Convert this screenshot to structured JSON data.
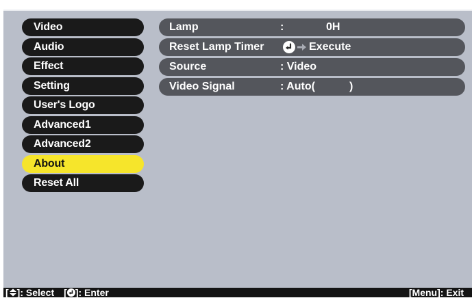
{
  "sidebar": {
    "items": [
      {
        "label": "Video"
      },
      {
        "label": "Audio"
      },
      {
        "label": "Effect"
      },
      {
        "label": "Setting"
      },
      {
        "label": "User's Logo"
      },
      {
        "label": "Advanced1"
      },
      {
        "label": "Advanced2"
      },
      {
        "label": "About",
        "selected": true
      },
      {
        "label": "Reset All"
      }
    ]
  },
  "panel": {
    "lamp": {
      "label": "Lamp",
      "colon": ":",
      "value": "0H"
    },
    "reset_lamp_timer": {
      "label": "Reset Lamp Timer",
      "action": "Execute",
      "icon": "enter-icon"
    },
    "source": {
      "label": "Source",
      "value": ": Video"
    },
    "video_signal": {
      "label": "Video Signal",
      "value": ": Auto(",
      "close": ")"
    }
  },
  "footer": {
    "select_open": "[",
    "select_label": "]: Select",
    "enter_open": "[",
    "enter_label": "]: Enter",
    "exit": "[Menu]: Exit"
  },
  "colors": {
    "background": "#b9bec9",
    "menu_item": "#1a1a1a",
    "menu_selected": "#f6e52b",
    "row": "#54565c",
    "footer": "#141414"
  }
}
